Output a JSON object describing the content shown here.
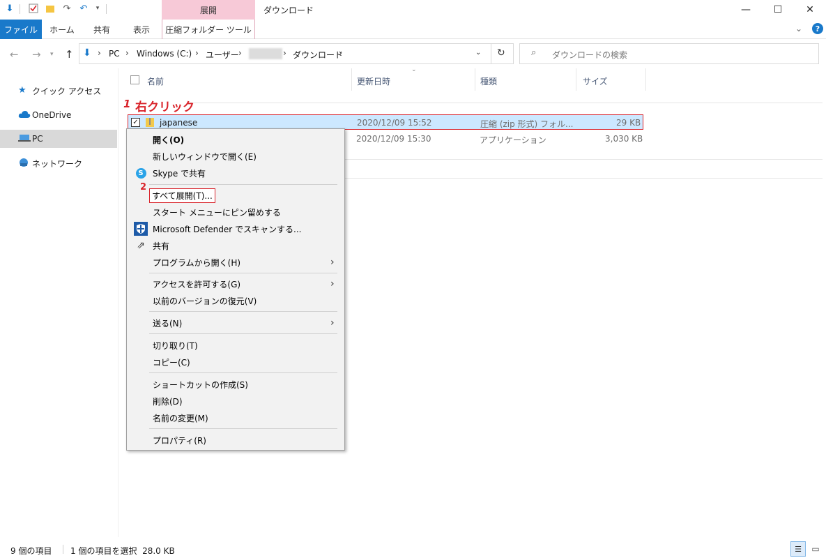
{
  "window": {
    "title": "ダウンロード",
    "context_tab_header": "展開",
    "minimize": "—",
    "maximize": "☐",
    "close": "✕"
  },
  "ribbon": {
    "file_tab": "ファイル",
    "tabs": [
      "ホーム",
      "共有",
      "表示"
    ],
    "compressed_tab": "圧縮フォルダー ツール"
  },
  "address": {
    "crumbs": [
      "PC",
      "Windows (C:)",
      "ユーザー",
      "ダウンロード"
    ],
    "search_placeholder": "ダウンロードの検索"
  },
  "sidebar": {
    "items": [
      {
        "label": "クイック アクセス",
        "icon": "star-icon"
      },
      {
        "label": "OneDrive",
        "icon": "cloud-icon"
      },
      {
        "label": "PC",
        "icon": "computer-icon"
      },
      {
        "label": "ネットワーク",
        "icon": "network-icon"
      }
    ]
  },
  "columns": {
    "name": "名前",
    "modified": "更新日時",
    "type": "種類",
    "size": "サイズ"
  },
  "files": [
    {
      "name": "japanese",
      "modified": "2020/12/09 15:52",
      "type": "圧縮 (zip 形式) フォル...",
      "size": "29 KB",
      "selected": true
    },
    {
      "name": "",
      "modified": "2020/12/09 15:30",
      "type": "アプリケーション",
      "size": "3,030 KB",
      "selected": false
    }
  ],
  "context_menu": {
    "items": [
      "開く(O)",
      "新しいウィンドウで開く(E)",
      "Skype で共有",
      "すべて展開(T)...",
      "スタート メニューにピン留めする",
      "Microsoft Defender でスキャンする...",
      "共有",
      "プログラムから開く(H)",
      "アクセスを許可する(G)",
      "以前のバージョンの復元(V)",
      "送る(N)",
      "切り取り(T)",
      "コピー(C)",
      "ショートカットの作成(S)",
      "削除(D)",
      "名前の変更(M)",
      "プロパティ(R)"
    ]
  },
  "annotations": {
    "step1_number": "1",
    "step1_text": "右クリック",
    "step2_number": "2"
  },
  "status": {
    "count": "9 個の項目",
    "selection": "1 個の項目を選択  28.0 KB"
  },
  "colors": {
    "accent": "#1979ca",
    "context_tab": "#f7c9d7",
    "selection": "#cce8ff",
    "annotation": "#d9242b"
  }
}
